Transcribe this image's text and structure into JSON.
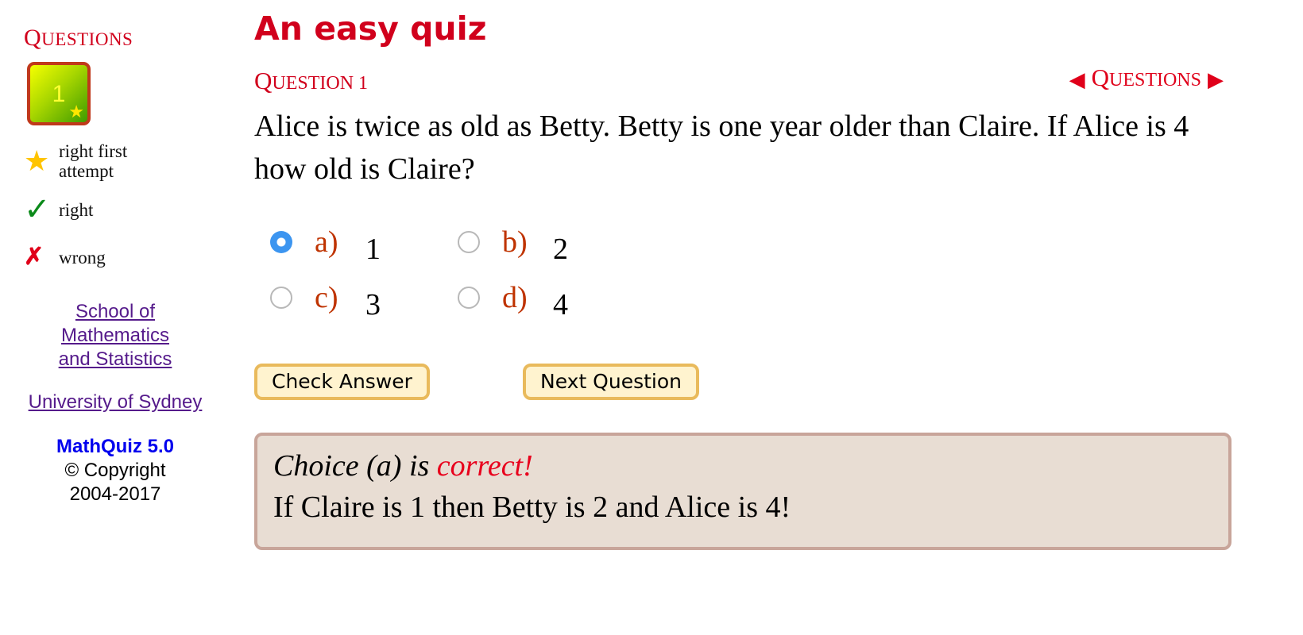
{
  "sidebar": {
    "heading_first": "Q",
    "heading_rest": "UESTIONS",
    "question_box": {
      "number": "1",
      "status_icon": "star-icon"
    },
    "legend": [
      {
        "icon": "star-icon",
        "glyph": "★",
        "label": "right first attempt"
      },
      {
        "icon": "check-icon",
        "glyph": "✓",
        "label": "right"
      },
      {
        "icon": "cross-icon",
        "glyph": "✗",
        "label": "wrong"
      }
    ],
    "school_link": "School of Mathematics and Statistics",
    "university_link": "University of Sydney",
    "mathquiz_version": "MathQuiz 5.0",
    "copyright": "© Copyright",
    "years": "2004-2017"
  },
  "main": {
    "title": "An easy quiz",
    "question_label_first": "Q",
    "question_label_rest": "UESTION 1",
    "nav": {
      "prev_glyph": "◀",
      "label_first": "Q",
      "label_rest": "UESTIONS",
      "next_glyph": "▶"
    },
    "question_text": "Alice is twice as old as Betty. Betty is one year older than Claire. If Alice is 4 how old is Claire?",
    "choices": [
      {
        "letter": "a)",
        "value": "1",
        "selected": true
      },
      {
        "letter": "b)",
        "value": "2",
        "selected": false
      },
      {
        "letter": "c)",
        "value": "3",
        "selected": false
      },
      {
        "letter": "d)",
        "value": "4",
        "selected": false
      }
    ],
    "check_answer_label": "Check Answer",
    "next_question_label": "Next Question",
    "feedback": {
      "prefix": "Choice (a) is ",
      "verdict": "correct!",
      "explanation": "If Claire is 1 then Betty is 2 and Alice is 4!"
    }
  },
  "colors": {
    "accent_red": "#d1001c",
    "choice_letter": "#bf3300",
    "button_bg": "#fff3cf",
    "button_border": "#e9ba5c",
    "feedback_bg": "#e8ddd3",
    "feedback_border": "#c8a59a",
    "link": "#551a8b"
  }
}
